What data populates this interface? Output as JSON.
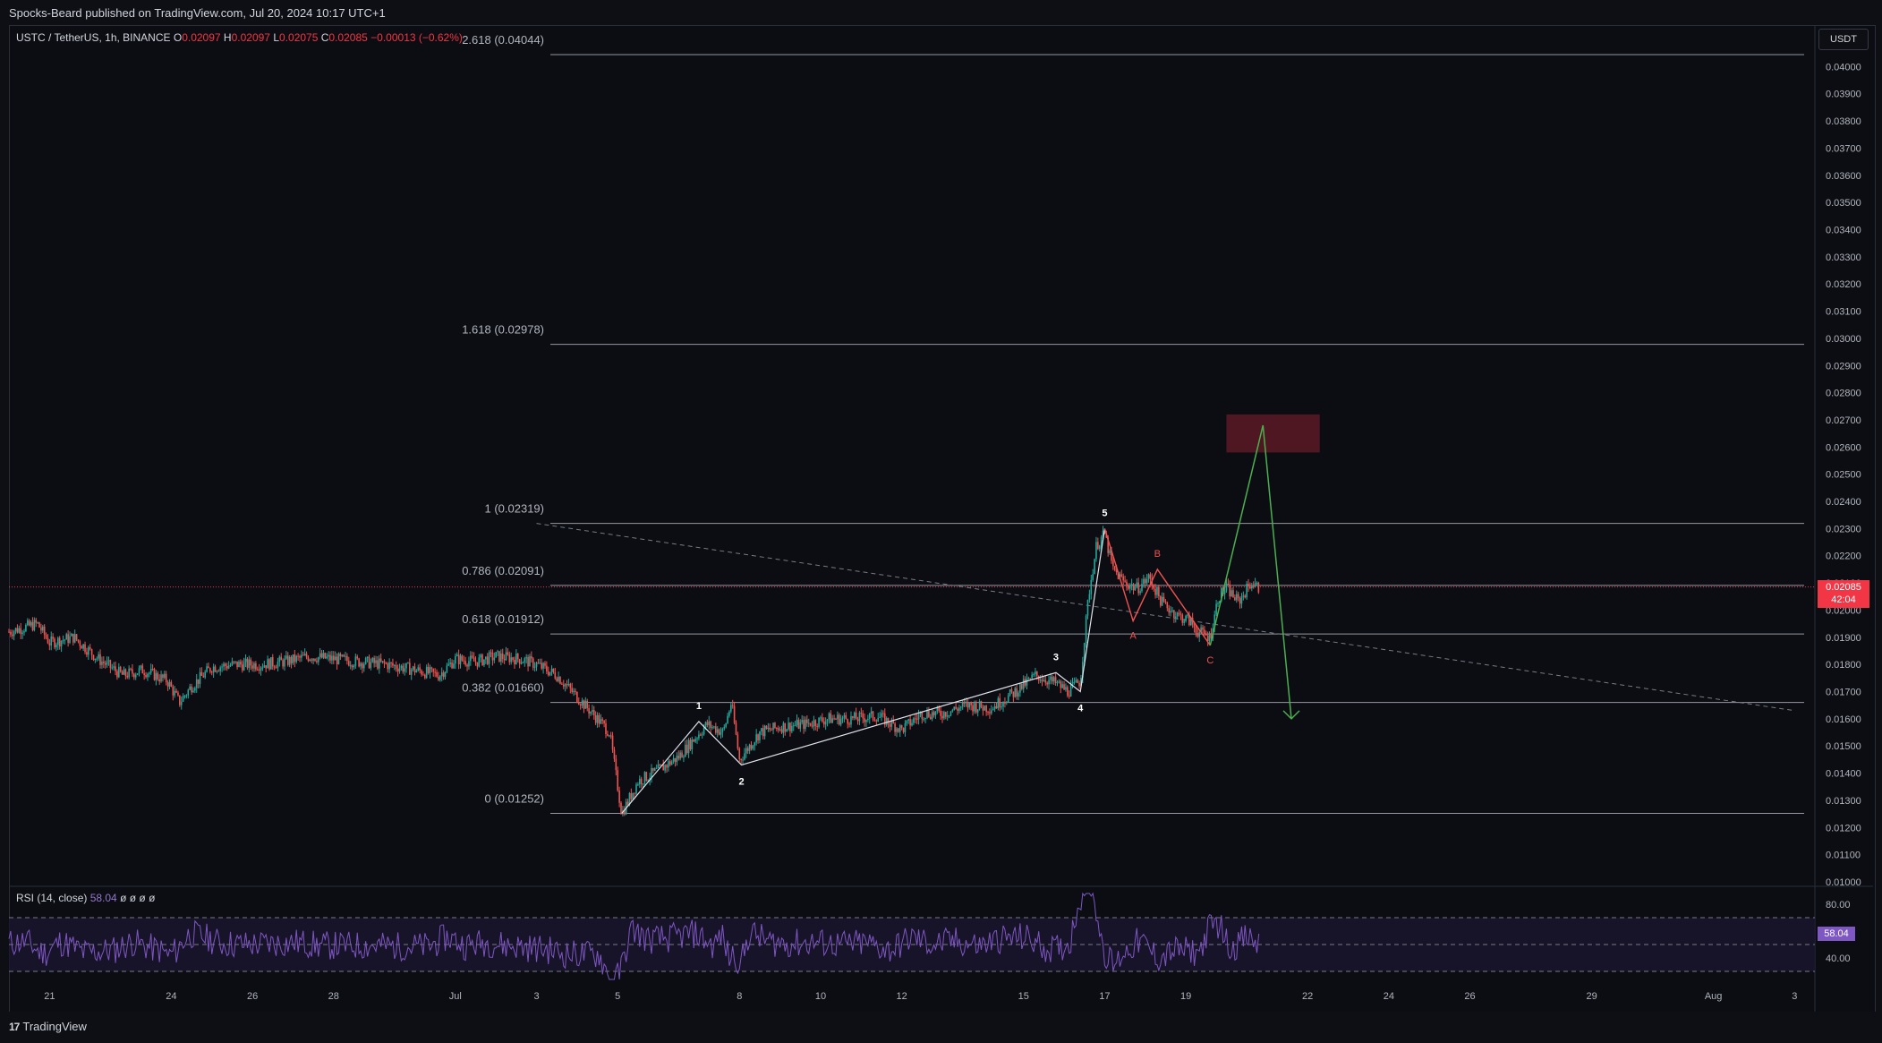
{
  "header": {
    "published": "Spocks-Beard published on TradingView.com, Jul 20, 2024 10:17 UTC+1"
  },
  "symbol": {
    "name": "USTC / TetherUS, 1h, BINANCE",
    "o_label": "O",
    "o": "0.02097",
    "h_label": "H",
    "h": "0.02097",
    "l_label": "L",
    "l": "0.02075",
    "c_label": "C",
    "c": "0.02085",
    "change": "−0.00013 (−0.62%)"
  },
  "currency_button": "USDT",
  "last_price": {
    "value": "0.02085",
    "countdown": "42:04"
  },
  "rsi": {
    "legend": "RSI (14, close)",
    "value": "58.04",
    "extras": "ø ø ø ø",
    "axis_labels": [
      "80.00",
      "40.00"
    ]
  },
  "footer": {
    "brand": "TradingView",
    "logo_glyph": "17"
  },
  "colors": {
    "background": "#0b0d12",
    "up": "#26a69a",
    "down": "#ef5350",
    "rsi": "#7e57c2",
    "last_price": "#f23645",
    "projection": "#4caf50",
    "target_zone": "#5a1a24"
  },
  "chart_data": {
    "type": "candlestick",
    "symbol": "USTC / TetherUS",
    "interval": "1h",
    "ylim": [
      0.01,
      0.041
    ],
    "y_ticks": [
      "0.04000",
      "0.03900",
      "0.03800",
      "0.03700",
      "0.03600",
      "0.03500",
      "0.03400",
      "0.03300",
      "0.03200",
      "0.03100",
      "0.03000",
      "0.02900",
      "0.02800",
      "0.02700",
      "0.02600",
      "0.02500",
      "0.02400",
      "0.02300",
      "0.02200",
      "0.02100",
      "0.02000",
      "0.01900",
      "0.01800",
      "0.01700",
      "0.01600",
      "0.01500",
      "0.01400",
      "0.01300",
      "0.01200",
      "0.01100",
      "0.01000"
    ],
    "x_ticks": [
      {
        "label": "21",
        "day": 21
      },
      {
        "label": "24",
        "day": 24
      },
      {
        "label": "26",
        "day": 26
      },
      {
        "label": "28",
        "day": 28
      },
      {
        "label": "Jul",
        "day": 31
      },
      {
        "label": "3",
        "day": 33
      },
      {
        "label": "5",
        "day": 35
      },
      {
        "label": "8",
        "day": 38
      },
      {
        "label": "10",
        "day": 40
      },
      {
        "label": "12",
        "day": 42
      },
      {
        "label": "15",
        "day": 45
      },
      {
        "label": "17",
        "day": 47
      },
      {
        "label": "19",
        "day": 49
      },
      {
        "label": "22",
        "day": 52
      },
      {
        "label": "24",
        "day": 54
      },
      {
        "label": "26",
        "day": 56
      },
      {
        "label": "29",
        "day": 59
      },
      {
        "label": "Aug",
        "day": 62
      },
      {
        "label": "3",
        "day": 64
      }
    ],
    "fib_levels": [
      {
        "label": "2.618 (0.04044)",
        "price": 0.04044
      },
      {
        "label": "1.618 (0.02978)",
        "price": 0.02978
      },
      {
        "label": "1 (0.02319)",
        "price": 0.02319
      },
      {
        "label": "0.786 (0.02091)",
        "price": 0.02091
      },
      {
        "label": "0.618 (0.01912)",
        "price": 0.01912
      },
      {
        "label": "0.382 (0.01660)",
        "price": 0.0166
      },
      {
        "label": "0 (0.01252)",
        "price": 0.01252
      }
    ],
    "price_path": [
      [
        20.0,
        0.0192
      ],
      [
        20.7,
        0.0195
      ],
      [
        21.0,
        0.0188
      ],
      [
        21.6,
        0.019
      ],
      [
        22.2,
        0.0182
      ],
      [
        22.8,
        0.0176
      ],
      [
        23.3,
        0.0178
      ],
      [
        23.9,
        0.0174
      ],
      [
        24.2,
        0.0166
      ],
      [
        24.5,
        0.0172
      ],
      [
        25.0,
        0.0179
      ],
      [
        25.6,
        0.018
      ],
      [
        26.2,
        0.018
      ],
      [
        26.8,
        0.0181
      ],
      [
        27.4,
        0.0183
      ],
      [
        28.0,
        0.0182
      ],
      [
        28.6,
        0.0181
      ],
      [
        29.3,
        0.018
      ],
      [
        30.0,
        0.0178
      ],
      [
        30.6,
        0.0176
      ],
      [
        31.0,
        0.0182
      ],
      [
        31.5,
        0.0181
      ],
      [
        32.0,
        0.0183
      ],
      [
        32.6,
        0.0182
      ],
      [
        33.0,
        0.018
      ],
      [
        33.5,
        0.0176
      ],
      [
        34.0,
        0.0168
      ],
      [
        34.5,
        0.016
      ],
      [
        34.8,
        0.0155
      ],
      [
        35.1,
        0.0125
      ],
      [
        35.5,
        0.0137
      ],
      [
        36.0,
        0.0141
      ],
      [
        36.5,
        0.0146
      ],
      [
        37.2,
        0.0158
      ],
      [
        37.6,
        0.0155
      ],
      [
        37.8,
        0.0166
      ],
      [
        38.0,
        0.0145
      ],
      [
        38.5,
        0.0155
      ],
      [
        39.0,
        0.0157
      ],
      [
        39.6,
        0.0158
      ],
      [
        40.2,
        0.016
      ],
      [
        40.8,
        0.016
      ],
      [
        41.4,
        0.0161
      ],
      [
        42.0,
        0.0156
      ],
      [
        42.5,
        0.0162
      ],
      [
        43.0,
        0.0162
      ],
      [
        43.6,
        0.0165
      ],
      [
        44.2,
        0.0164
      ],
      [
        44.8,
        0.017
      ],
      [
        45.3,
        0.0176
      ],
      [
        45.8,
        0.0173
      ],
      [
        46.1,
        0.017
      ],
      [
        46.4,
        0.0174
      ],
      [
        46.6,
        0.0205
      ],
      [
        46.8,
        0.0224
      ],
      [
        47.0,
        0.0228
      ],
      [
        47.2,
        0.0215
      ],
      [
        47.5,
        0.021
      ],
      [
        47.8,
        0.0208
      ],
      [
        48.1,
        0.0212
      ],
      [
        48.4,
        0.0203
      ],
      [
        48.8,
        0.0198
      ],
      [
        49.1,
        0.0196
      ],
      [
        49.3,
        0.0192
      ],
      [
        49.6,
        0.019
      ],
      [
        49.8,
        0.0205
      ],
      [
        50.0,
        0.0208
      ],
      [
        50.3,
        0.0203
      ],
      [
        50.6,
        0.021
      ],
      [
        50.8,
        0.0208
      ]
    ],
    "elliott_impulse": [
      {
        "label": "",
        "day": 35.1,
        "price": 0.01252
      },
      {
        "label": "1",
        "day": 37.0,
        "price": 0.0159
      },
      {
        "label": "2",
        "day": 38.05,
        "price": 0.0143
      },
      {
        "label": "3",
        "day": 45.8,
        "price": 0.0177
      },
      {
        "label": "4",
        "day": 46.4,
        "price": 0.017
      },
      {
        "label": "5",
        "day": 47.0,
        "price": 0.023
      }
    ],
    "abc_correction": [
      {
        "label": "",
        "day": 47.0,
        "price": 0.023
      },
      {
        "label": "A",
        "day": 47.7,
        "price": 0.0196
      },
      {
        "label": "B",
        "day": 48.3,
        "price": 0.0215
      },
      {
        "label": "C",
        "day": 49.6,
        "price": 0.0187
      }
    ],
    "projection_path": [
      {
        "day": 49.6,
        "price": 0.0187
      },
      {
        "day": 50.9,
        "price": 0.0268
      },
      {
        "day": 51.6,
        "price": 0.016
      }
    ],
    "target_zone": {
      "day_start": 50.0,
      "day_end": 52.3,
      "price_low": 0.0258,
      "price_high": 0.0272
    },
    "trendline": {
      "day_start": 33.0,
      "price_start": 0.02319,
      "day_end": 64.0,
      "price_end": 0.0163
    },
    "last_price": 0.02085,
    "rsi_last": 58.04,
    "rsi_ylim": [
      20,
      90
    ],
    "rsi_bands": [
      70,
      50,
      30
    ]
  }
}
